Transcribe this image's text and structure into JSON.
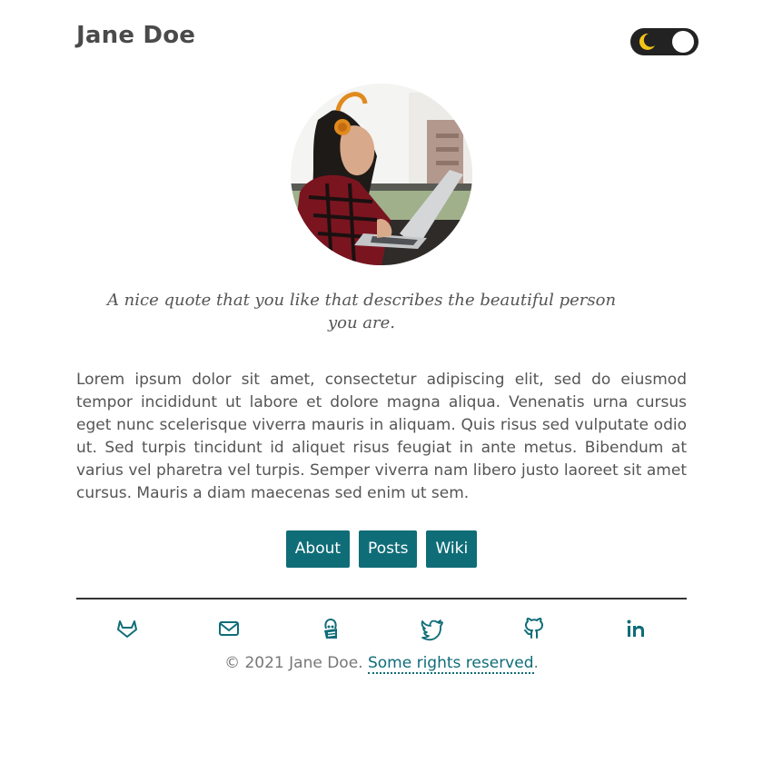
{
  "header": {
    "site_title": "Jane Doe"
  },
  "theme_toggle": {
    "mode": "dark",
    "icon": "moon-icon"
  },
  "profile": {
    "avatar_description_icon": "profile-photo",
    "quote": "A nice quote that you like that describes the beautiful person you are."
  },
  "bio": {
    "text": "Lorem ipsum dolor sit amet, consectetur adipiscing elit, sed do eiusmod tempor incididunt ut labore et dolore magna aliqua. Venenatis urna cursus eget nunc scelerisque viverra mauris in aliquam. Quis risus sed vulputate odio ut. Sed turpis tincidunt id aliquet risus feugiat in ante metus. Bibendum at varius vel pharetra vel turpis. Semper viverra nam libero justo laoreet sit amet cursus. Mauris a diam maecenas sed enim ut sem."
  },
  "nav": {
    "items": [
      {
        "label": "About"
      },
      {
        "label": "Posts"
      },
      {
        "label": "Wiki"
      }
    ]
  },
  "social": {
    "icons": [
      "gitlab-icon",
      "mail-icon",
      "keybase-icon",
      "twitter-icon",
      "github-icon",
      "linkedin-icon"
    ]
  },
  "footer": {
    "copyright": "© 2021 Jane Doe.",
    "link_text": "Some rights reserved",
    "trailing": "."
  },
  "colors": {
    "accent": "#0f6d78",
    "toggle_bg": "#222222",
    "moon": "#f2c419"
  }
}
